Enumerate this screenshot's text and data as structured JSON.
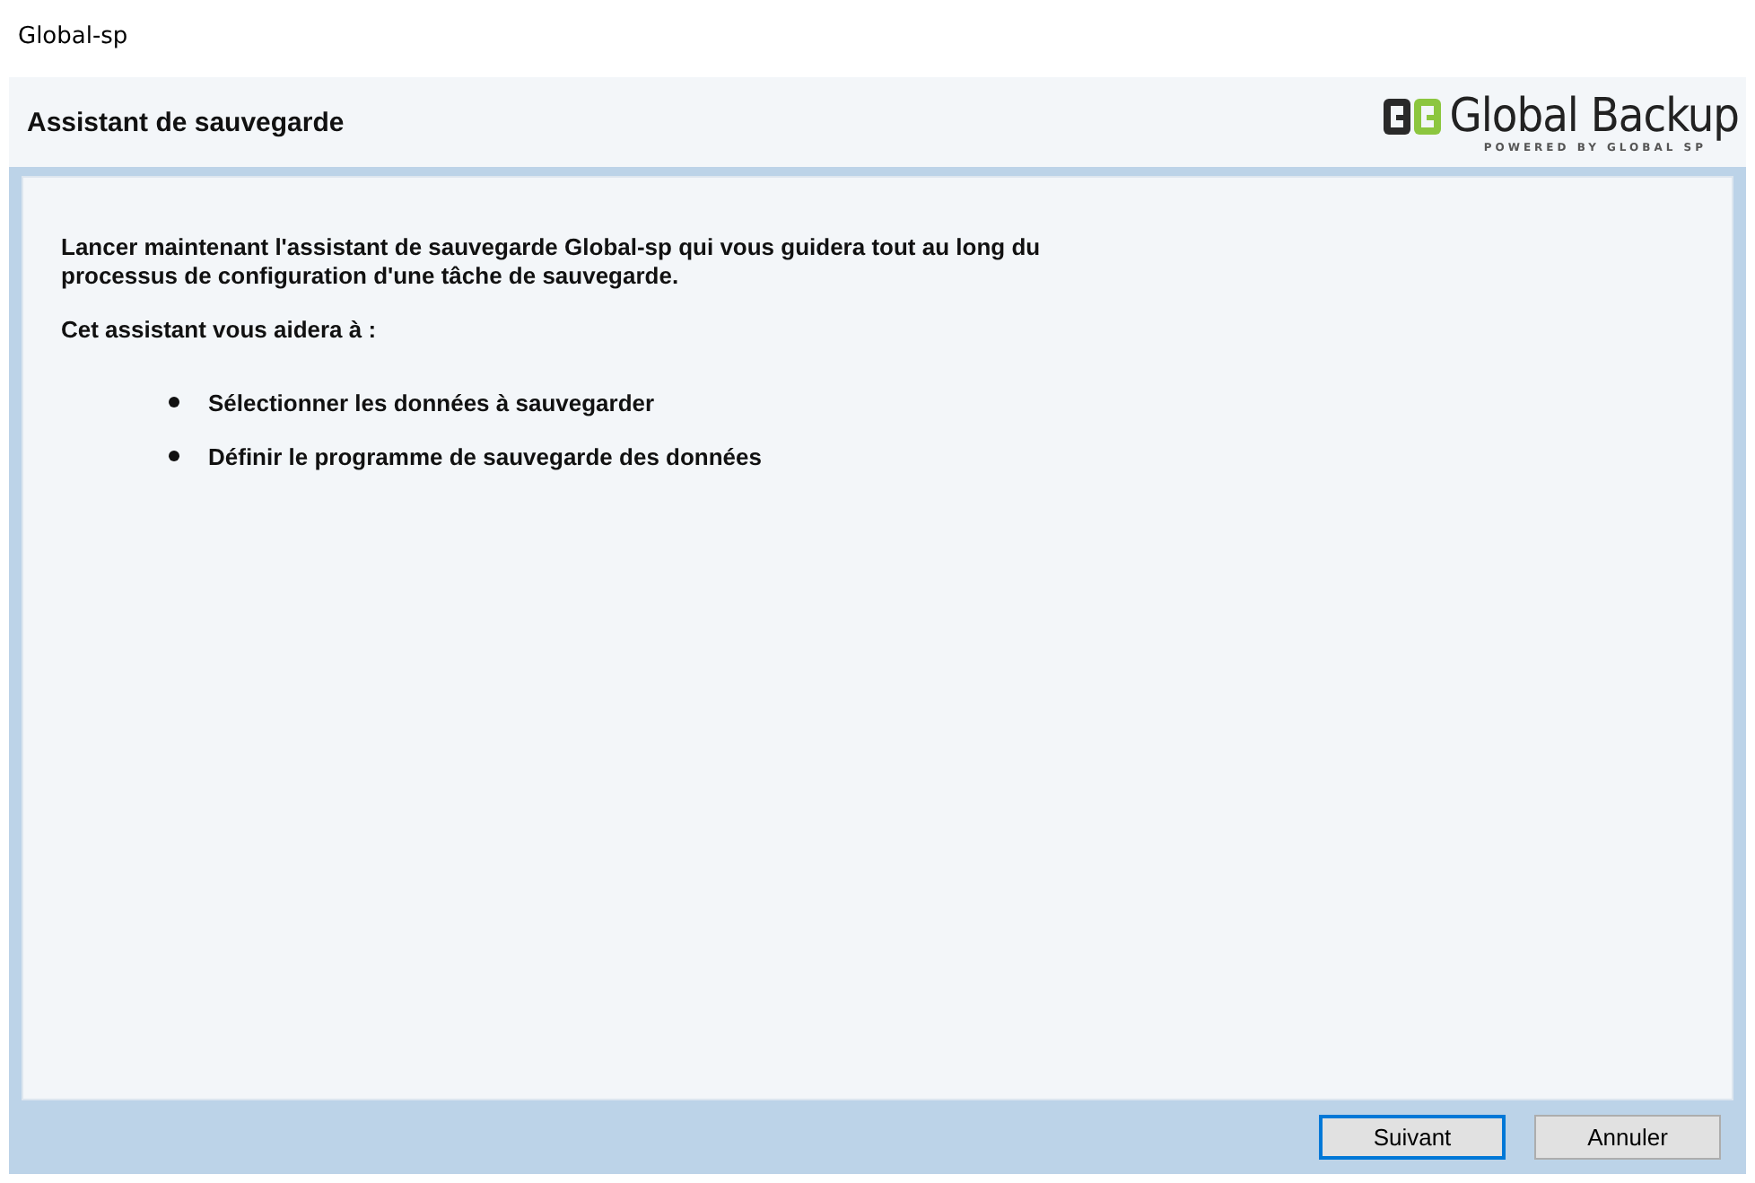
{
  "window": {
    "title": "Global-sp"
  },
  "header": {
    "title": "Assistant de sauvegarde",
    "logo": {
      "name": "Global Backup",
      "tagline": "POWERED BY GLOBAL SP"
    }
  },
  "content": {
    "intro": "Lancer maintenant l'assistant de sauvegarde Global-sp qui vous guidera tout au long du processus de configuration d'une tâche de sauvegarde.",
    "lead": "Cet assistant vous aidera à :",
    "steps": [
      "Sélectionner les données à sauvegarder",
      "Définir le programme de sauvegarde des données"
    ]
  },
  "buttons": [
    {
      "label": "Suivant",
      "default": true
    },
    {
      "label": "Annuler",
      "default": false
    }
  ]
}
